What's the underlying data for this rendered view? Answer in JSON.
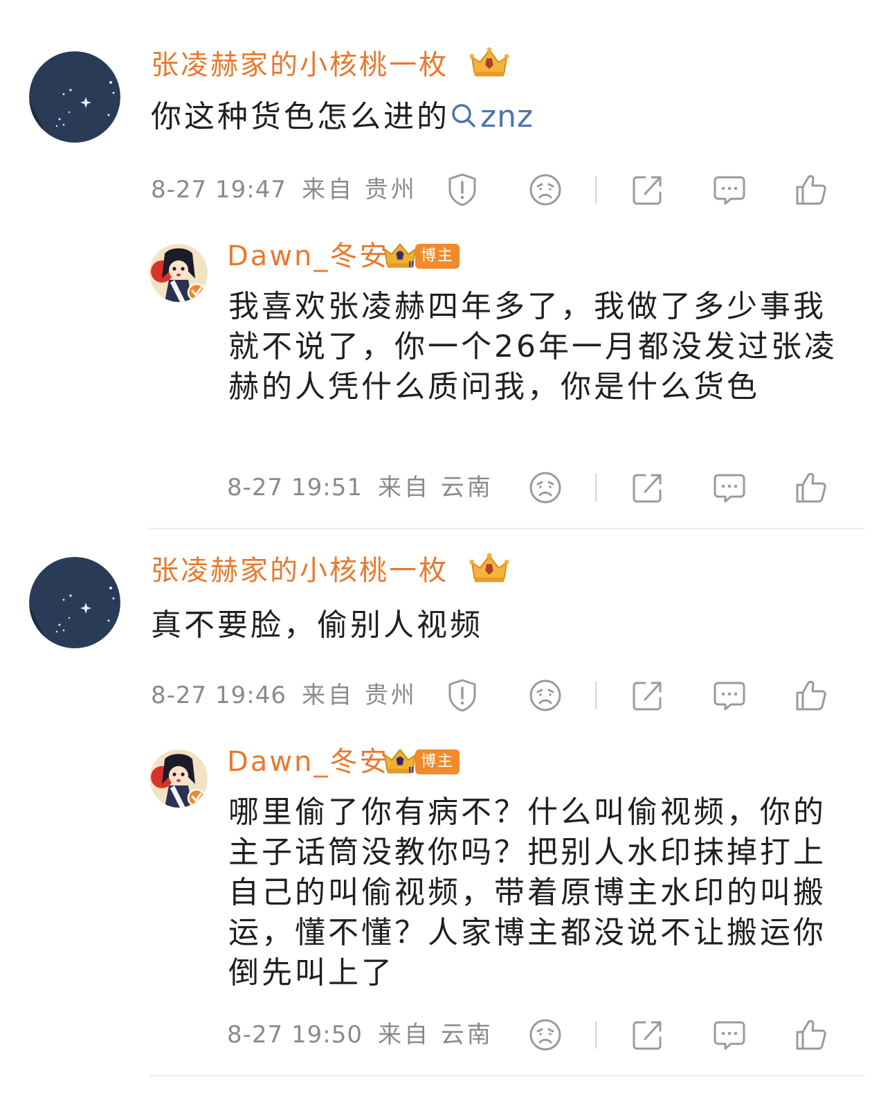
{
  "comments": [
    {
      "user": "张凌赫家的小核桃一枚",
      "text": "你这种货色怎么进的",
      "link": "znz",
      "time": "8-27 19:47",
      "location": "来自 贵州"
    },
    {
      "user": "Dawn_冬安",
      "tag": "博主",
      "text": "我喜欢张凌赫四年多了，我做了多少事我就不说了，你一个26年一月都没发过张凌赫的人凭什么质问我，你是什么货色",
      "time": "8-27 19:51",
      "location": "来自 云南"
    },
    {
      "user": "张凌赫家的小核桃一枚",
      "text": "真不要脸，偷别人视频",
      "time": "8-27 19:46",
      "location": "来自 贵州"
    },
    {
      "user": "Dawn_冬安",
      "tag": "博主",
      "text": "哪里偷了你有病不？什么叫偷视频，你的主子话筒没教你吗？把别人水印抹掉打上自己的叫偷视频，带着原博主水印的叫搬运，懂不懂？人家博主都没说不让搬运你倒先叫上了",
      "time": "8-27 19:50",
      "location": "来自 云南"
    }
  ],
  "colors": {
    "username": "#e8792e",
    "text": "#1f1f1f",
    "meta": "#8a8a8a",
    "link": "#4f74a8",
    "tag_bg": "#f08a2c"
  },
  "icons": [
    "report-icon",
    "dislike-icon",
    "share-icon",
    "reply-icon",
    "like-icon",
    "magnifier-icon",
    "crown-icon"
  ]
}
